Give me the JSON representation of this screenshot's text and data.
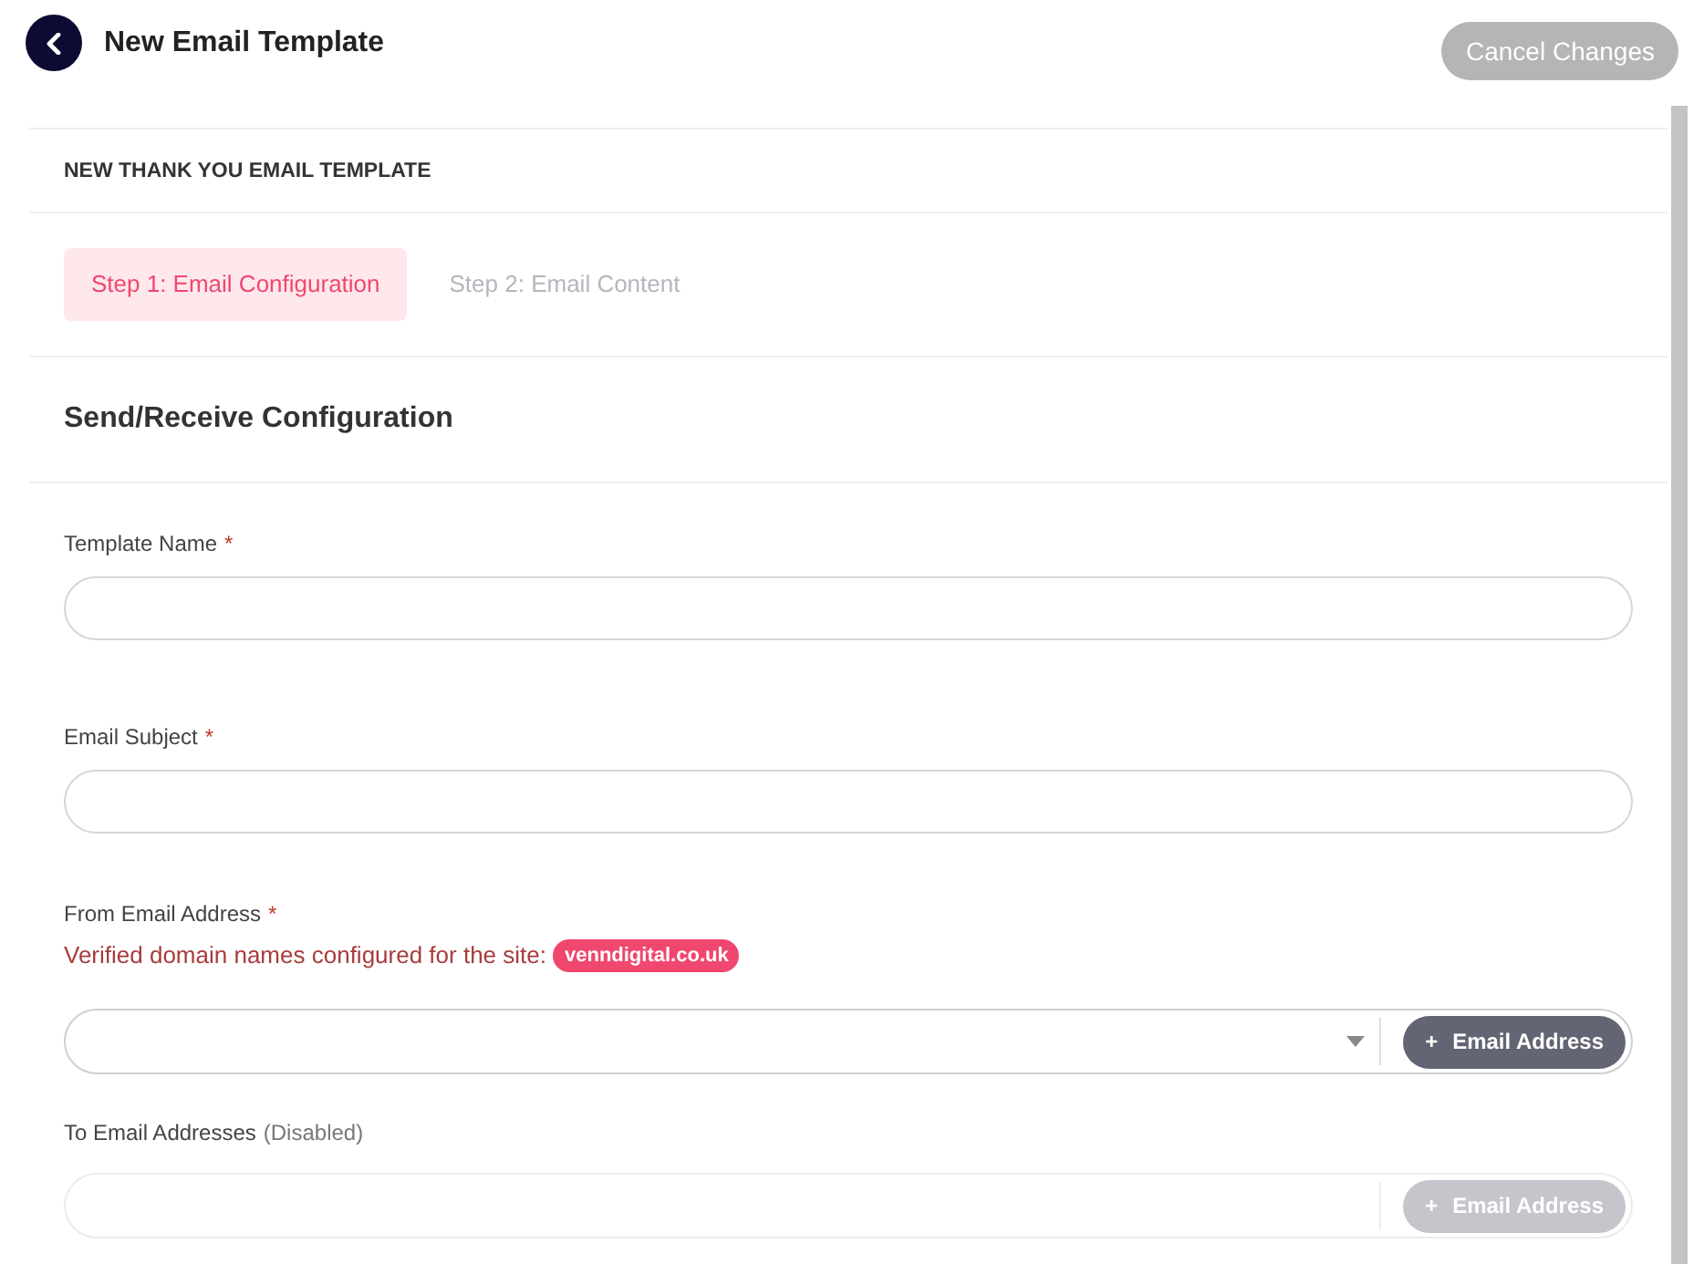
{
  "header": {
    "title": "New Email Template",
    "cancel_button": {
      "label": "Cancel Changes",
      "disabled": true
    }
  },
  "form_title": "NEW THANK YOU EMAIL TEMPLATE",
  "steps": [
    {
      "label": "Step 1: Email Configuration",
      "selected": true
    },
    {
      "label": "Step 2: Email Content",
      "selected": false
    }
  ],
  "section_title": "Send/Receive Configuration",
  "fields": [
    {
      "kind": "text",
      "label": "Template Name",
      "required_mark": "*"
    },
    {
      "kind": "text",
      "label": "Email Subject",
      "required_mark": "*"
    },
    {
      "kind": "select",
      "label": "From Email Address",
      "required_mark": "*",
      "hint": "Verified domain names configured for the site:",
      "domain": "venndigital.co.uk",
      "button": "Email Address",
      "button_icon": "+",
      "disabled": false
    },
    {
      "kind": "select",
      "label": "To Email Addresses",
      "note": "(Disabled)",
      "button": "Email Address",
      "button_icon": "+",
      "disabled": true
    }
  ]
}
